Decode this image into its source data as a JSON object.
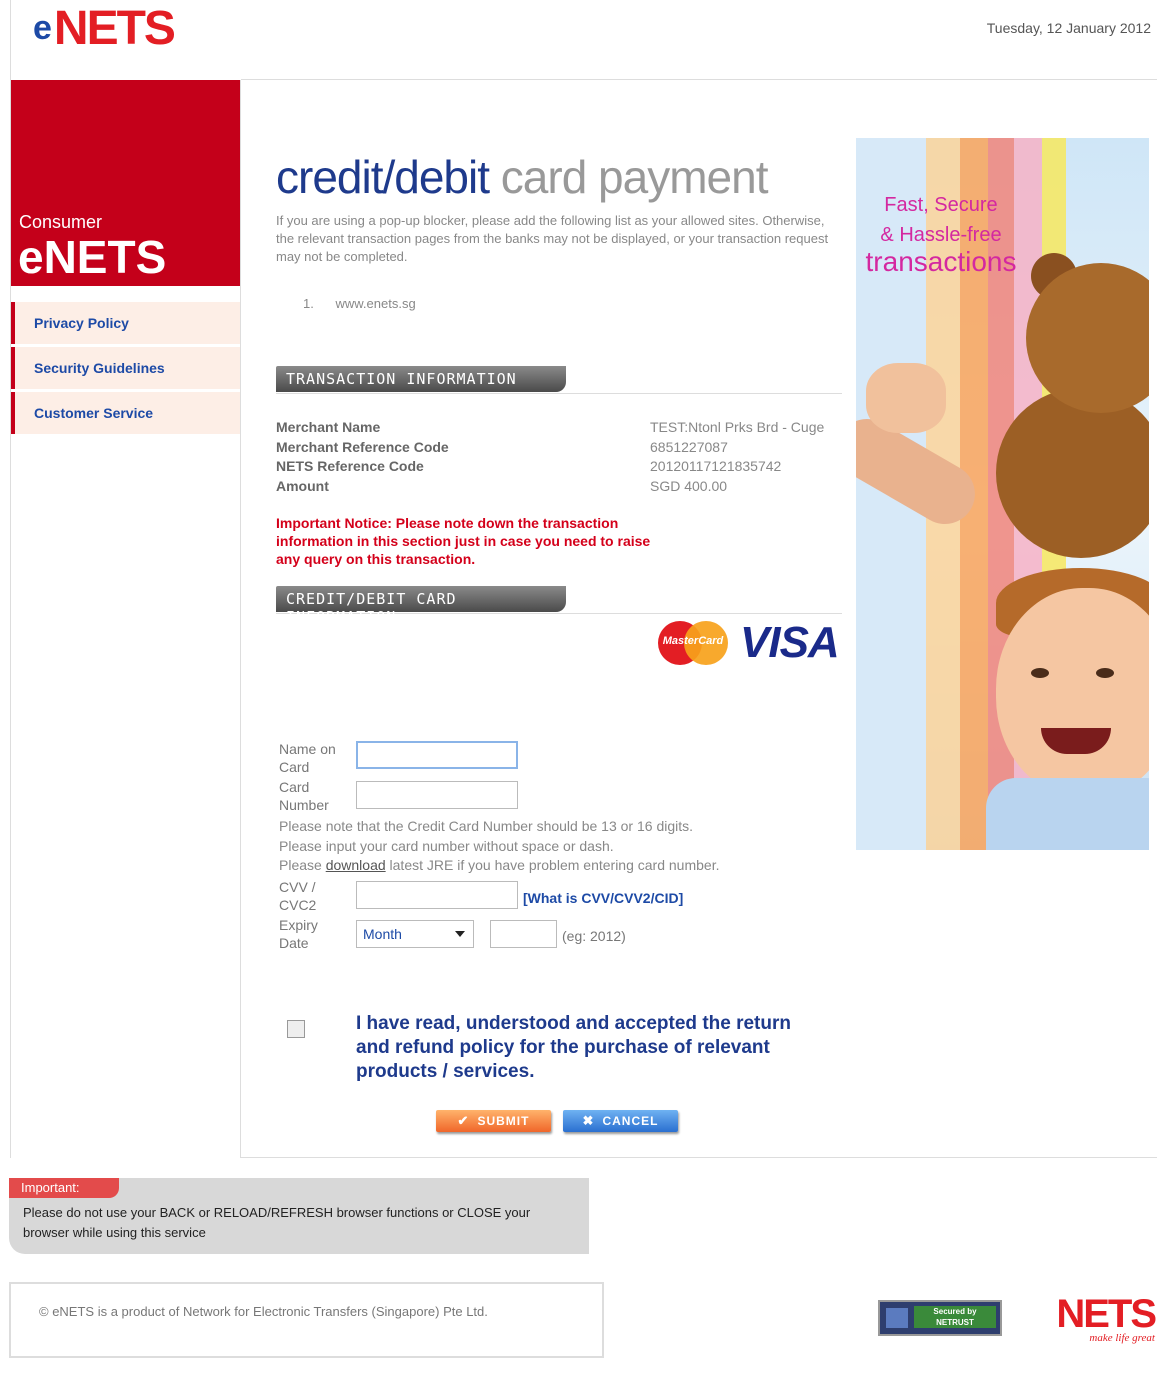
{
  "header": {
    "logo_e": "e",
    "logo_nets": "NETS",
    "date": "Tuesday, 12 January 2012"
  },
  "sidebar": {
    "consumer_label": "Consumer",
    "consumer_brand": "eNETS",
    "items": [
      {
        "label": "Privacy Policy"
      },
      {
        "label": "Security Guidelines"
      },
      {
        "label": "Customer Service"
      }
    ]
  },
  "main": {
    "title_part1": "credit/debit",
    "title_part2": "card payment",
    "intro": "If you are using a pop-up blocker, please add the following list as your allowed sites. Otherwise, the relevant transaction pages from the banks may not be displayed, or your transaction request may not be completed.",
    "allowed_sites": [
      {
        "num": "1.",
        "site": "www.enets.sg"
      }
    ],
    "section_transaction": "Transaction Information",
    "transaction_rows": [
      {
        "key": "Merchant Name",
        "value": "TEST:Ntonl Prks Brd - Cuge"
      },
      {
        "key": "Merchant Reference Code",
        "value": "6851227087"
      },
      {
        "key": "NETS Reference Code",
        "value": "20120117121835742"
      },
      {
        "key": "Amount",
        "value": "SGD 400.00"
      }
    ],
    "notice": "Important Notice: Please note down the transaction information in this section just in case you need to raise any query on this transaction.",
    "section_card": "Credit/Debit Card Information",
    "card_logos": {
      "mastercard": "MasterCard",
      "visa": "VISA"
    }
  },
  "form": {
    "name_label_1": "Name on",
    "name_label_2": "Card",
    "name_value": "",
    "number_label_1": "Card",
    "number_label_2": "Number",
    "number_value": "",
    "help_1": "Please note that the Credit Card Number should be 13 or 16 digits.",
    "help_2": "Please input your card number without space or dash.",
    "help_3_pre": "Please ",
    "help_3_link": "download",
    "help_3_post": " latest JRE if you have problem entering card number.",
    "cvv_label_1": "CVV /",
    "cvv_label_2": "CVC2",
    "cvv_value": "",
    "cvv_link": "[What is CVV/CVV2/CID]",
    "expiry_label_1": "Expiry",
    "expiry_label_2": "Date",
    "month_selected": "Month",
    "year_value": "",
    "year_hint": "(eg: 2012)",
    "agree_text": "I have read, understood and accepted the return and refund policy for the purchase of relevant products / services.",
    "agree_checked": false,
    "submit_label": "Submit",
    "cancel_label": "Cancel"
  },
  "banner": {
    "line1": "Fast, Secure",
    "line2": "& Hassle-free",
    "line3": "transactions",
    "stripe_colors": [
      "#d7e9f8",
      "#fbd49a",
      "#f9a35a",
      "#f0847a",
      "#f6b2c6",
      "#f7e85e"
    ]
  },
  "footer": {
    "important_tag": "Important:",
    "important_msg": "Please do not use your BACK or RELOAD/REFRESH browser functions or CLOSE your browser while using this service",
    "copyright": "© eNETS is a product of Network for Electronic Transfers (Singapore) Pte Ltd.",
    "netrust_text": "Secured by NETRUST",
    "nets_logo": "NETS",
    "nets_tagline": "make life great"
  },
  "colors": {
    "brand_red": "#c4001a",
    "brand_blue": "#1e3a8c",
    "notice_red": "#d4001a"
  }
}
